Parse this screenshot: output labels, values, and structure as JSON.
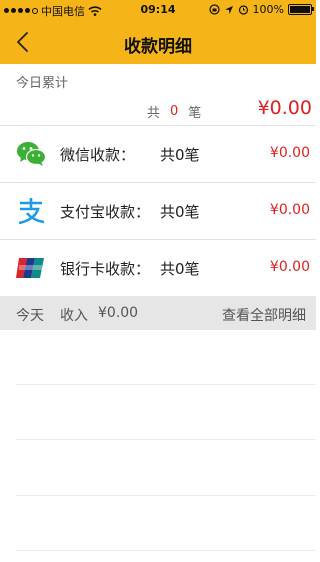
{
  "status_bar": {
    "carrier": "中国电信",
    "time": "09:14",
    "battery": "100%",
    "battery_level": 1.0
  },
  "nav": {
    "title": "收款明细"
  },
  "summary": {
    "label": "今日累计",
    "count_prefix": "共",
    "count": "0",
    "count_suffix": "笔",
    "amount": "¥0.00"
  },
  "payments": [
    {
      "icon": "wechat-icon",
      "label": "微信收款：",
      "count": "共0笔",
      "amount": "¥0.00"
    },
    {
      "icon": "alipay-icon",
      "label": "支付宝收款：",
      "count": "共0笔",
      "amount": "¥0.00"
    },
    {
      "icon": "unionpay-icon",
      "label": "银行卡收款：",
      "count": "共0笔",
      "amount": "¥0.00"
    }
  ],
  "today_bar": {
    "today": "今天",
    "income": "收入",
    "total": "¥0.00",
    "view_all": "查看全部明细"
  },
  "colors": {
    "accent": "#f5b518",
    "amount": "#e02020"
  }
}
